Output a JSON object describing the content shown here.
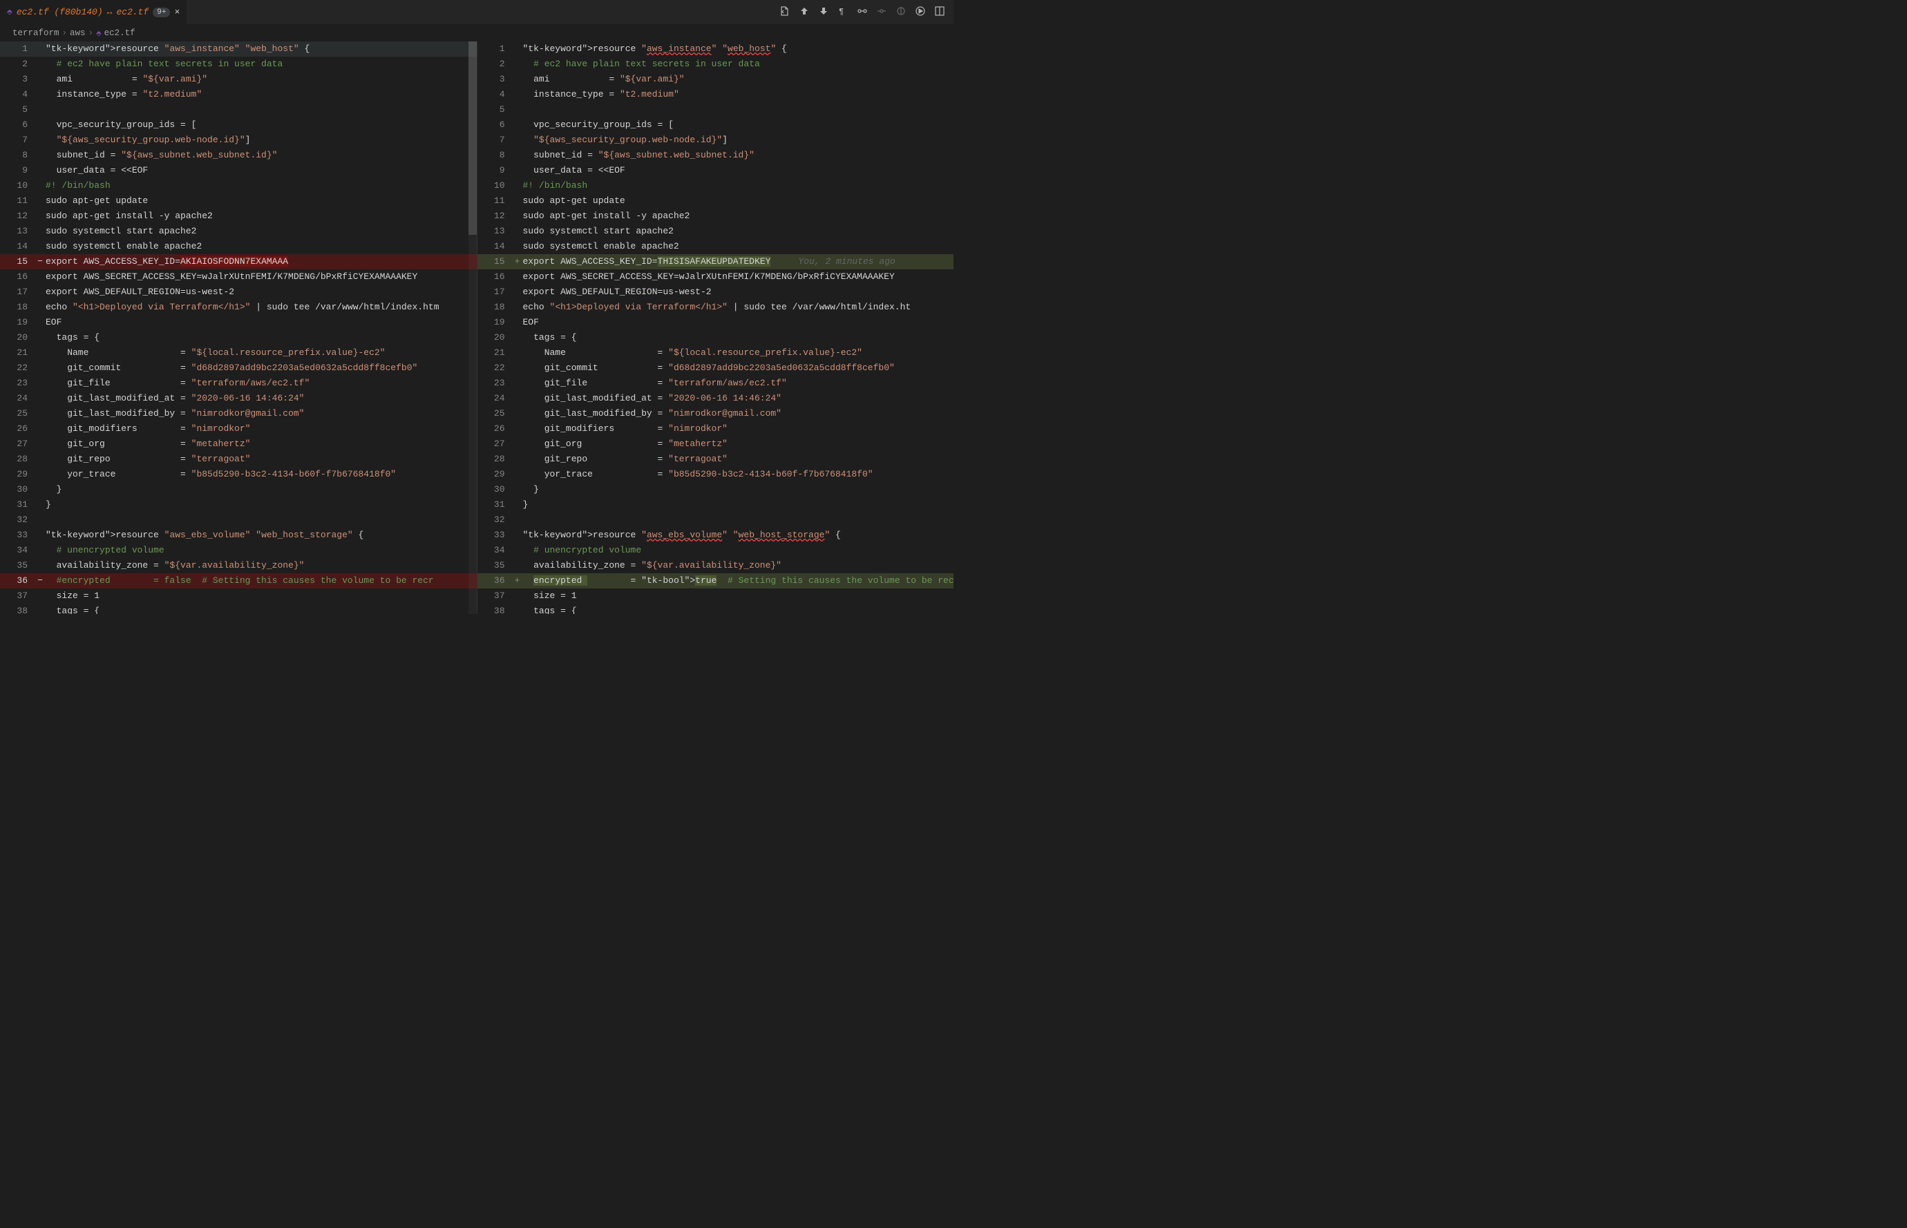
{
  "tab": {
    "title_left": "ec2.tf (f80b140)",
    "arrows": "↔",
    "title_right": "ec2.tf",
    "git_count": "9+",
    "close": "×"
  },
  "breadcrumb": {
    "seg1": "terraform",
    "seg2": "aws",
    "seg3": "ec2.tf"
  },
  "annotation_blame": "You, 2 minutes ago",
  "left_lines": [
    {
      "n": 1,
      "m": "",
      "t": "resource \"aws_instance\" \"web_host\" {",
      "cls": "cursor-highlight"
    },
    {
      "n": 2,
      "m": "",
      "t": "  # ec2 have plain text secrets in user data"
    },
    {
      "n": 3,
      "m": "",
      "t": "  ami           = \"${var.ami}\""
    },
    {
      "n": 4,
      "m": "",
      "t": "  instance_type = \"t2.medium\""
    },
    {
      "n": 5,
      "m": "",
      "t": ""
    },
    {
      "n": 6,
      "m": "",
      "t": "  vpc_security_group_ids = ["
    },
    {
      "n": 7,
      "m": "",
      "t": "  \"${aws_security_group.web-node.id}\"]"
    },
    {
      "n": 8,
      "m": "",
      "t": "  subnet_id = \"${aws_subnet.web_subnet.id}\""
    },
    {
      "n": 9,
      "m": "",
      "t": "  user_data = <<EOF"
    },
    {
      "n": 10,
      "m": "",
      "t": "#! /bin/bash"
    },
    {
      "n": 11,
      "m": "",
      "t": "sudo apt-get update"
    },
    {
      "n": 12,
      "m": "",
      "t": "sudo apt-get install -y apache2"
    },
    {
      "n": 13,
      "m": "",
      "t": "sudo systemctl start apache2"
    },
    {
      "n": 14,
      "m": "",
      "t": "sudo systemctl enable apache2"
    },
    {
      "n": 15,
      "m": "−",
      "t": "export AWS_ACCESS_KEY_ID=AKIAIOSFODNN7EXAMAAA",
      "diff": "removed"
    },
    {
      "n": 16,
      "m": "",
      "t": "export AWS_SECRET_ACCESS_KEY=wJalrXUtnFEMI/K7MDENG/bPxRfiCYEXAMAAAKEY"
    },
    {
      "n": 17,
      "m": "",
      "t": "export AWS_DEFAULT_REGION=us-west-2"
    },
    {
      "n": 18,
      "m": "",
      "t": "echo \"<h1>Deployed via Terraform</h1>\" | sudo tee /var/www/html/index.htm"
    },
    {
      "n": 19,
      "m": "",
      "t": "EOF"
    },
    {
      "n": 20,
      "m": "",
      "t": "  tags = {"
    },
    {
      "n": 21,
      "m": "",
      "t": "    Name                 = \"${local.resource_prefix.value}-ec2\""
    },
    {
      "n": 22,
      "m": "",
      "t": "    git_commit           = \"d68d2897add9bc2203a5ed0632a5cdd8ff8cefb0\""
    },
    {
      "n": 23,
      "m": "",
      "t": "    git_file             = \"terraform/aws/ec2.tf\""
    },
    {
      "n": 24,
      "m": "",
      "t": "    git_last_modified_at = \"2020-06-16 14:46:24\""
    },
    {
      "n": 25,
      "m": "",
      "t": "    git_last_modified_by = \"nimrodkor@gmail.com\""
    },
    {
      "n": 26,
      "m": "",
      "t": "    git_modifiers        = \"nimrodkor\""
    },
    {
      "n": 27,
      "m": "",
      "t": "    git_org              = \"metahertz\""
    },
    {
      "n": 28,
      "m": "",
      "t": "    git_repo             = \"terragoat\""
    },
    {
      "n": 29,
      "m": "",
      "t": "    yor_trace            = \"b85d5290-b3c2-4134-b60f-f7b6768418f0\""
    },
    {
      "n": 30,
      "m": "",
      "t": "  }"
    },
    {
      "n": 31,
      "m": "",
      "t": "}"
    },
    {
      "n": 32,
      "m": "",
      "t": ""
    },
    {
      "n": 33,
      "m": "",
      "t": "resource \"aws_ebs_volume\" \"web_host_storage\" {"
    },
    {
      "n": 34,
      "m": "",
      "t": "  # unencrypted volume"
    },
    {
      "n": 35,
      "m": "",
      "t": "  availability_zone = \"${var.availability_zone}\""
    },
    {
      "n": 36,
      "m": "−",
      "t": "  #encrypted        = false  # Setting this causes the volume to be recr",
      "diff": "removed"
    },
    {
      "n": 37,
      "m": "",
      "t": "  size = 1"
    },
    {
      "n": 38,
      "m": "",
      "t": "  tags = {"
    }
  ],
  "right_lines": [
    {
      "n": 1,
      "m": "",
      "t": "resource \"aws_instance\" \"web_host\" {",
      "squiggly": [
        "aws_instance",
        "web_host"
      ]
    },
    {
      "n": 2,
      "m": "",
      "t": "  # ec2 have plain text secrets in user data"
    },
    {
      "n": 3,
      "m": "",
      "t": "  ami           = \"${var.ami}\""
    },
    {
      "n": 4,
      "m": "",
      "t": "  instance_type = \"t2.medium\""
    },
    {
      "n": 5,
      "m": "",
      "t": ""
    },
    {
      "n": 6,
      "m": "",
      "t": "  vpc_security_group_ids = ["
    },
    {
      "n": 7,
      "m": "",
      "t": "  \"${aws_security_group.web-node.id}\"]"
    },
    {
      "n": 8,
      "m": "",
      "t": "  subnet_id = \"${aws_subnet.web_subnet.id}\""
    },
    {
      "n": 9,
      "m": "",
      "t": "  user_data = <<EOF"
    },
    {
      "n": 10,
      "m": "",
      "t": "#! /bin/bash"
    },
    {
      "n": 11,
      "m": "",
      "t": "sudo apt-get update"
    },
    {
      "n": 12,
      "m": "",
      "t": "sudo apt-get install -y apache2"
    },
    {
      "n": 13,
      "m": "",
      "t": "sudo systemctl start apache2"
    },
    {
      "n": 14,
      "m": "",
      "t": "sudo systemctl enable apache2"
    },
    {
      "n": 15,
      "m": "+",
      "t": "export AWS_ACCESS_KEY_ID=THISISAFAKEUPDATEDKEY",
      "diff": "added",
      "blame": true
    },
    {
      "n": 16,
      "m": "",
      "t": "export AWS_SECRET_ACCESS_KEY=wJalrXUtnFEMI/K7MDENG/bPxRfiCYEXAMAAAKEY"
    },
    {
      "n": 17,
      "m": "",
      "t": "export AWS_DEFAULT_REGION=us-west-2"
    },
    {
      "n": 18,
      "m": "",
      "t": "echo \"<h1>Deployed via Terraform</h1>\" | sudo tee /var/www/html/index.ht"
    },
    {
      "n": 19,
      "m": "",
      "t": "EOF"
    },
    {
      "n": 20,
      "m": "",
      "t": "  tags = {"
    },
    {
      "n": 21,
      "m": "",
      "t": "    Name                 = \"${local.resource_prefix.value}-ec2\""
    },
    {
      "n": 22,
      "m": "",
      "t": "    git_commit           = \"d68d2897add9bc2203a5ed0632a5cdd8ff8cefb0\""
    },
    {
      "n": 23,
      "m": "",
      "t": "    git_file             = \"terraform/aws/ec2.tf\""
    },
    {
      "n": 24,
      "m": "",
      "t": "    git_last_modified_at = \"2020-06-16 14:46:24\""
    },
    {
      "n": 25,
      "m": "",
      "t": "    git_last_modified_by = \"nimrodkor@gmail.com\""
    },
    {
      "n": 26,
      "m": "",
      "t": "    git_modifiers        = \"nimrodkor\""
    },
    {
      "n": 27,
      "m": "",
      "t": "    git_org              = \"metahertz\""
    },
    {
      "n": 28,
      "m": "",
      "t": "    git_repo             = \"terragoat\""
    },
    {
      "n": 29,
      "m": "",
      "t": "    yor_trace            = \"b85d5290-b3c2-4134-b60f-f7b6768418f0\""
    },
    {
      "n": 30,
      "m": "",
      "t": "  }"
    },
    {
      "n": 31,
      "m": "",
      "t": "}"
    },
    {
      "n": 32,
      "m": "",
      "t": ""
    },
    {
      "n": 33,
      "m": "",
      "t": "resource \"aws_ebs_volume\" \"web_host_storage\" {",
      "squiggly": [
        "aws_ebs_volume",
        "web_host_storage"
      ]
    },
    {
      "n": 34,
      "m": "",
      "t": "  # unencrypted volume"
    },
    {
      "n": 35,
      "m": "",
      "t": "  availability_zone = \"${var.availability_zone}\""
    },
    {
      "n": 36,
      "m": "+",
      "t": "  encrypted         = true  # Setting this causes the volume to be recre",
      "diff": "added"
    },
    {
      "n": 37,
      "m": "",
      "t": "  size = 1"
    },
    {
      "n": 38,
      "m": "",
      "t": "  tags = {"
    }
  ]
}
